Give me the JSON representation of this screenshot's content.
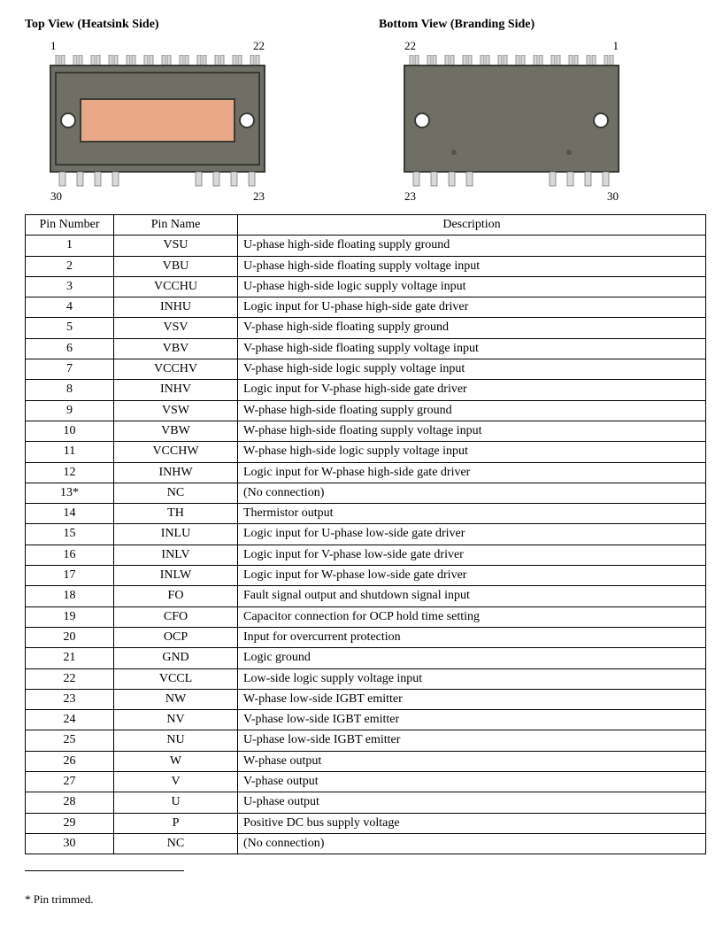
{
  "views": {
    "top": {
      "title": "Top View (Heatsink Side)",
      "tl": "1",
      "tr": "22",
      "bl": "30",
      "br": "23"
    },
    "bottom": {
      "title": "Bottom View (Branding Side)",
      "tl": "22",
      "tr": "1",
      "bl": "23",
      "br": "30"
    }
  },
  "table": {
    "headers": {
      "pin": "Pin Number",
      "name": "Pin Name",
      "desc": "Description"
    },
    "rows": [
      {
        "pin": "1",
        "name": "VSU",
        "desc": "U-phase high-side floating supply ground"
      },
      {
        "pin": "2",
        "name": "VBU",
        "desc": "U-phase high-side floating supply voltage input"
      },
      {
        "pin": "3",
        "name": "VCCHU",
        "desc": "U-phase high-side logic supply voltage input"
      },
      {
        "pin": "4",
        "name": "INHU",
        "desc": "Logic input for U-phase high-side gate driver"
      },
      {
        "pin": "5",
        "name": "VSV",
        "desc": "V-phase high-side floating supply ground"
      },
      {
        "pin": "6",
        "name": "VBV",
        "desc": "V-phase high-side floating supply voltage input"
      },
      {
        "pin": "7",
        "name": "VCCHV",
        "desc": "V-phase high-side logic supply voltage input"
      },
      {
        "pin": "8",
        "name": "INHV",
        "desc": "Logic input for V-phase high-side gate driver"
      },
      {
        "pin": "9",
        "name": "VSW",
        "desc": "W-phase high-side floating supply ground"
      },
      {
        "pin": "10",
        "name": "VBW",
        "desc": "W-phase high-side floating supply voltage input"
      },
      {
        "pin": "11",
        "name": "VCCHW",
        "desc": "W-phase high-side logic supply voltage input"
      },
      {
        "pin": "12",
        "name": "INHW",
        "desc": "Logic input for W-phase high-side gate driver"
      },
      {
        "pin": "13*",
        "name": "NC",
        "desc": "(No connection)"
      },
      {
        "pin": "14",
        "name": "TH",
        "desc": "Thermistor output"
      },
      {
        "pin": "15",
        "name": "INLU",
        "desc": "Logic input for U-phase low-side gate driver"
      },
      {
        "pin": "16",
        "name": "INLV",
        "desc": "Logic input for V-phase low-side gate driver"
      },
      {
        "pin": "17",
        "name": "INLW",
        "desc": "Logic input for W-phase low-side gate driver"
      },
      {
        "pin": "18",
        "name": "FO",
        "desc": "Fault signal output and shutdown signal input"
      },
      {
        "pin": "19",
        "name": "CFO",
        "desc": "Capacitor connection for OCP hold time setting"
      },
      {
        "pin": "20",
        "name": "OCP",
        "desc": "Input for overcurrent protection"
      },
      {
        "pin": "21",
        "name": "GND",
        "desc": "Logic ground"
      },
      {
        "pin": "22",
        "name": "VCCL",
        "desc": "Low-side logic supply voltage input"
      },
      {
        "pin": "23",
        "name": "NW",
        "desc": "W-phase low-side IGBT emitter"
      },
      {
        "pin": "24",
        "name": "NV",
        "desc": "V-phase low-side IGBT emitter"
      },
      {
        "pin": "25",
        "name": "NU",
        "desc": "U-phase low-side IGBT emitter"
      },
      {
        "pin": "26",
        "name": "W",
        "desc": "W-phase output"
      },
      {
        "pin": "27",
        "name": "V",
        "desc": "V-phase output"
      },
      {
        "pin": "28",
        "name": "U",
        "desc": "U-phase output"
      },
      {
        "pin": "29",
        "name": "P",
        "desc": "Positive DC bus supply voltage"
      },
      {
        "pin": "30",
        "name": "NC",
        "desc": "(No connection)"
      }
    ]
  },
  "footnote": "*  Pin trimmed."
}
